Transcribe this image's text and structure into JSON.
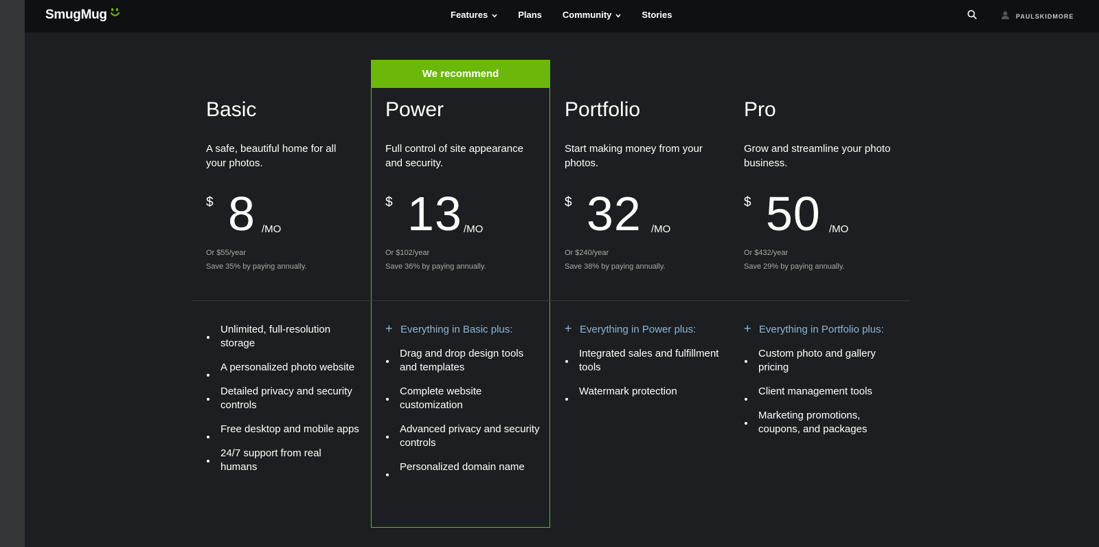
{
  "header": {
    "logo": "SmugMug",
    "nav": [
      {
        "label": "Features",
        "has_dropdown": true
      },
      {
        "label": "Plans",
        "has_dropdown": false
      },
      {
        "label": "Community",
        "has_dropdown": true
      },
      {
        "label": "Stories",
        "has_dropdown": false
      }
    ],
    "user_name": "PAULSKIDMORE"
  },
  "recommend_banner": "We recommend",
  "plans": [
    {
      "name": "Basic",
      "description": "A safe, beautiful home for all your photos.",
      "currency": "$",
      "price": "8",
      "period": "/MO",
      "yearly": "Or $55/year",
      "save": "Save 35% by paying annually.",
      "features": [
        {
          "text": "Unlimited, full-resolution storage"
        },
        {
          "text": "A personalized photo website"
        },
        {
          "text": "Detailed privacy and security controls"
        },
        {
          "text": "Free desktop and mobile apps"
        },
        {
          "text": "24/7 support from real humans"
        }
      ]
    },
    {
      "name": "Power",
      "description": "Full control of site appearance and security.",
      "currency": "$",
      "price": "13",
      "period": "/MO",
      "yearly": "Or $102/year",
      "save": "Save 36% by paying annually.",
      "features": [
        {
          "text": "Everything in Basic plus:",
          "plus": true
        },
        {
          "text": "Drag and drop design tools and templates"
        },
        {
          "text": "Complete website customization"
        },
        {
          "text": "Advanced privacy and security controls"
        },
        {
          "text": "Personalized domain name"
        }
      ]
    },
    {
      "name": "Portfolio",
      "description": "Start making money from your photos.",
      "currency": "$",
      "price": "32",
      "period": "/MO",
      "yearly": "Or $240/year",
      "save": "Save 38% by paying annually.",
      "features": [
        {
          "text": "Everything in Power plus:",
          "plus": true
        },
        {
          "text": "Integrated sales and fulfillment tools"
        },
        {
          "text": "Watermark protection"
        }
      ]
    },
    {
      "name": "Pro",
      "description": "Grow and streamline your photo business.",
      "currency": "$",
      "price": "50",
      "period": "/MO",
      "yearly": "Or $432/year",
      "save": "Save 29% by paying annually.",
      "features": [
        {
          "text": "Everything in Portfolio plus:",
          "plus": true
        },
        {
          "text": "Custom photo and gallery pricing"
        },
        {
          "text": "Client management tools"
        },
        {
          "text": "Marketing promotions, coupons, and packages"
        }
      ]
    }
  ],
  "colors": {
    "accent": "#6cb80a",
    "plus_text": "#8fb5d6",
    "background": "#1d1e21",
    "topbar": "#0f1012"
  }
}
